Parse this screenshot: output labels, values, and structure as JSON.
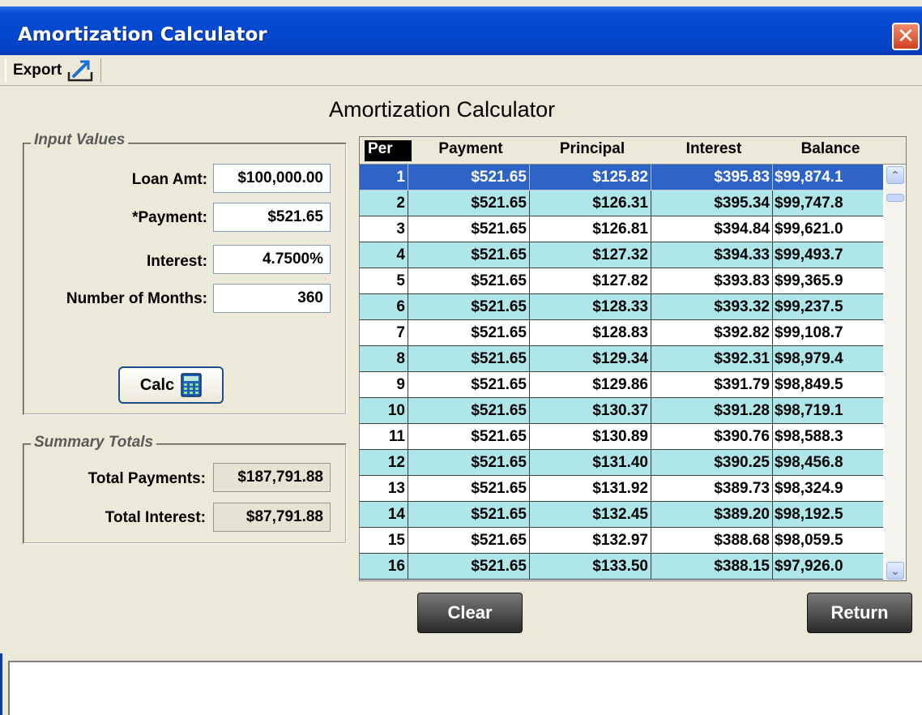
{
  "window": {
    "title": "Amortization Calculator",
    "close_glyph": "✕"
  },
  "menubar": {
    "export_label": "Export",
    "export_icon": "export-icon"
  },
  "page": {
    "heading": "Amortization Calculator"
  },
  "input_values": {
    "group_title": "Input Values",
    "loan_amt_label": "Loan Amt:",
    "loan_amt_value": "$100,000.00",
    "payment_label": "*Payment:",
    "payment_value": "$521.65",
    "interest_label": "Interest:",
    "interest_value": "4.7500%",
    "months_label": "Number of Months:",
    "months_value": "360",
    "calc_label": "Calc",
    "calc_icon": "calculator-icon"
  },
  "summary": {
    "group_title": "Summary Totals",
    "total_payments_label": "Total Payments:",
    "total_payments_value": "$187,791.88",
    "total_interest_label": "Total Interest:",
    "total_interest_value": "$87,791.88"
  },
  "table": {
    "headers": [
      "Per",
      "Payment",
      "Principal",
      "Interest",
      "Balance"
    ],
    "selected_row": 1,
    "rows": [
      [
        "1",
        "$521.65",
        "$125.82",
        "$395.83",
        "$99,874.1"
      ],
      [
        "2",
        "$521.65",
        "$126.31",
        "$395.34",
        "$99,747.8"
      ],
      [
        "3",
        "$521.65",
        "$126.81",
        "$394.84",
        "$99,621.0"
      ],
      [
        "4",
        "$521.65",
        "$127.32",
        "$394.33",
        "$99,493.7"
      ],
      [
        "5",
        "$521.65",
        "$127.82",
        "$393.83",
        "$99,365.9"
      ],
      [
        "6",
        "$521.65",
        "$128.33",
        "$393.32",
        "$99,237.5"
      ],
      [
        "7",
        "$521.65",
        "$128.83",
        "$392.82",
        "$99,108.7"
      ],
      [
        "8",
        "$521.65",
        "$129.34",
        "$392.31",
        "$98,979.4"
      ],
      [
        "9",
        "$521.65",
        "$129.86",
        "$391.79",
        "$98,849.5"
      ],
      [
        "10",
        "$521.65",
        "$130.37",
        "$391.28",
        "$98,719.1"
      ],
      [
        "11",
        "$521.65",
        "$130.89",
        "$390.76",
        "$98,588.3"
      ],
      [
        "12",
        "$521.65",
        "$131.40",
        "$390.25",
        "$98,456.8"
      ],
      [
        "13",
        "$521.65",
        "$131.92",
        "$389.73",
        "$98,324.9"
      ],
      [
        "14",
        "$521.65",
        "$132.45",
        "$389.20",
        "$98,192.5"
      ],
      [
        "15",
        "$521.65",
        "$132.97",
        "$388.68",
        "$98,059.5"
      ],
      [
        "16",
        "$521.65",
        "$133.50",
        "$388.15",
        "$97,926.0"
      ]
    ],
    "scroll_up_glyph": "⌃",
    "scroll_down_glyph": "⌄"
  },
  "buttons": {
    "clear_label": "Clear",
    "return_label": "Return"
  },
  "colors": {
    "titlebar": "#0447cf",
    "row_even": "#afe6ea",
    "row_selected": "#2d62c6",
    "window_bg": "#ece9d8"
  }
}
